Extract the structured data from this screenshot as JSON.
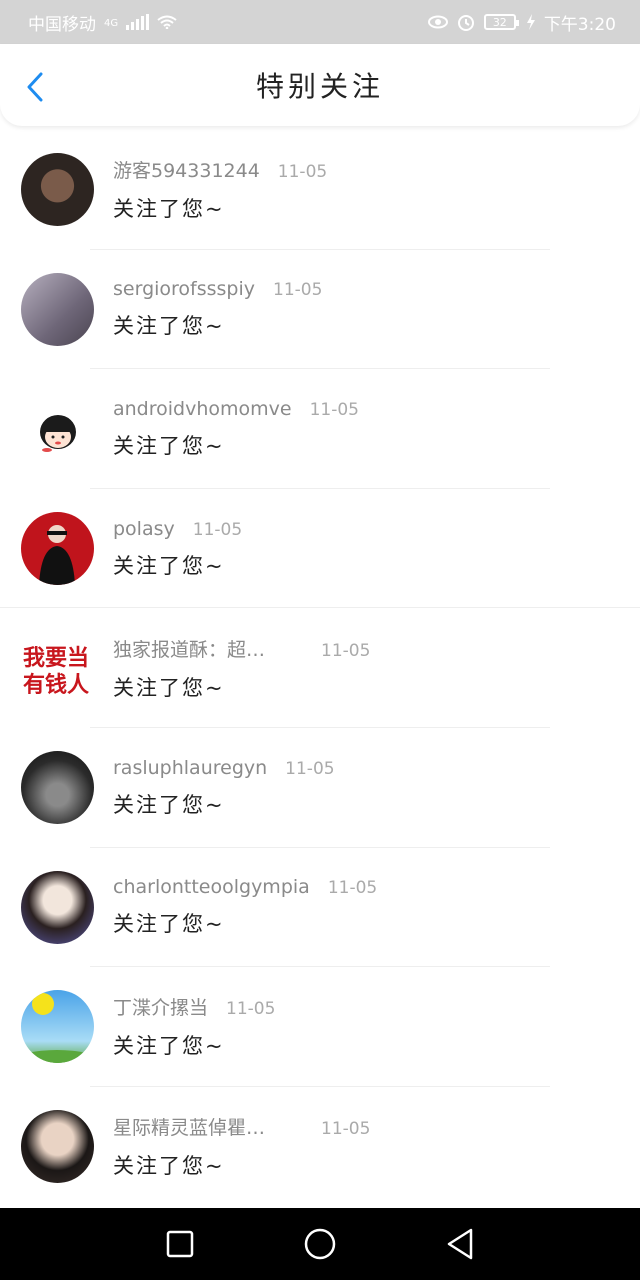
{
  "status_bar": {
    "carrier": "中国移动",
    "network": "4G",
    "battery": "32",
    "time": "下午3:20",
    "icons": [
      "signal-icon",
      "wifi-icon",
      "eye-icon",
      "alarm-icon",
      "battery-icon",
      "charging-icon"
    ]
  },
  "header": {
    "title": "特别关注",
    "back_icon": "chevron-left-icon",
    "accent_color": "#1e8cf0"
  },
  "items": [
    {
      "username": "游客594331244",
      "date": "11-05",
      "action": "关注了您~"
    },
    {
      "username": "sergiorofssspiy",
      "date": "11-05",
      "action": "关注了您~"
    },
    {
      "username": "androidvhomomve",
      "date": "11-05",
      "action": "关注了您~"
    },
    {
      "username": "polasy",
      "date": "11-05",
      "action": "关注了您~"
    },
    {
      "username": "独家报道酥：超…",
      "date": "11-05",
      "action": "关注了您~",
      "avatar_text": "我要当有钱人"
    },
    {
      "username": "rasluphlauregyn",
      "date": "11-05",
      "action": "关注了您~"
    },
    {
      "username": "charlontteoolgympia",
      "date": "11-05",
      "action": "关注了您~"
    },
    {
      "username": "丁渫介摞当",
      "date": "11-05",
      "action": "关注了您~"
    },
    {
      "username": "星际精灵蓝倬瞿…",
      "date": "11-05",
      "action": "关注了您~"
    }
  ],
  "system_nav": {
    "icons": [
      "square-recents-icon",
      "circle-home-icon",
      "triangle-back-icon"
    ]
  }
}
